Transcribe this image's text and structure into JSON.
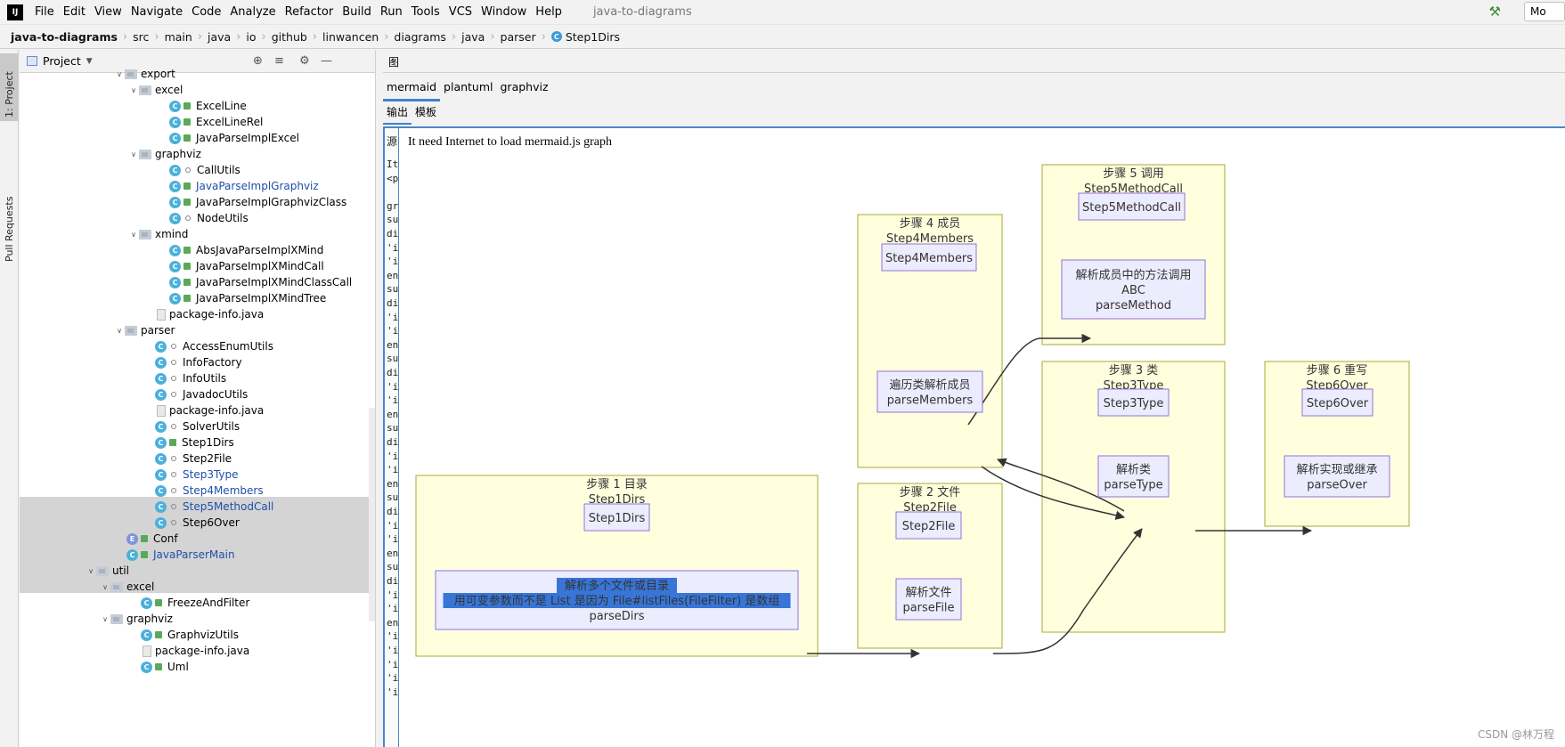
{
  "app": {
    "logo": "IJ",
    "window_title": "java-to-diagrams",
    "menu": [
      "File",
      "Edit",
      "View",
      "Navigate",
      "Code",
      "Analyze",
      "Refactor",
      "Build",
      "Run",
      "Tools",
      "VCS",
      "Window",
      "Help"
    ]
  },
  "breadcrumbs": [
    "java-to-diagrams",
    "src",
    "main",
    "java",
    "io",
    "github",
    "linwancen",
    "diagrams",
    "java",
    "parser",
    "Step1Dirs"
  ],
  "toolbar": {
    "run_config_label": "Mo",
    "hammer_icon": "hammer-icon"
  },
  "tool_stripe": {
    "project": "1: Project",
    "pull_requests": "Pull Requests"
  },
  "project_panel": {
    "title": "Project",
    "tree": [
      {
        "label": "export",
        "type": "folder",
        "arrow": "down"
      },
      {
        "label": "excel",
        "type": "folder",
        "arrow": "down"
      },
      {
        "label": "ExcelLine",
        "type": "class",
        "mod": "pub"
      },
      {
        "label": "ExcelLineRel",
        "type": "class",
        "mod": "pub"
      },
      {
        "label": "JavaParseImplExcel",
        "type": "class",
        "mod": "pub"
      },
      {
        "label": "graphviz",
        "type": "folder",
        "arrow": "down"
      },
      {
        "label": "CallUtils",
        "type": "class",
        "mod": "pkg"
      },
      {
        "label": "JavaParseImplGraphviz",
        "type": "class",
        "mod": "pub",
        "color": "blue"
      },
      {
        "label": "JavaParseImplGraphvizClass",
        "type": "class",
        "mod": "pub"
      },
      {
        "label": "NodeUtils",
        "type": "class",
        "mod": "pkg"
      },
      {
        "label": "xmind",
        "type": "folder",
        "arrow": "down"
      },
      {
        "label": "AbsJavaParseImplXMind",
        "type": "class",
        "mod": "pub"
      },
      {
        "label": "JavaParseImplXMindCall",
        "type": "class",
        "mod": "pub"
      },
      {
        "label": "JavaParseImplXMindClassCall",
        "type": "class",
        "mod": "pub"
      },
      {
        "label": "JavaParseImplXMindTree",
        "type": "class",
        "mod": "pub"
      },
      {
        "label": "package-info.java",
        "type": "file"
      },
      {
        "label": "parser",
        "type": "folder",
        "arrow": "down"
      },
      {
        "label": "AccessEnumUtils",
        "type": "class",
        "mod": "pkg"
      },
      {
        "label": "InfoFactory",
        "type": "class",
        "mod": "pkg"
      },
      {
        "label": "InfoUtils",
        "type": "class",
        "mod": "pkg"
      },
      {
        "label": "JavadocUtils",
        "type": "class",
        "mod": "pkg"
      },
      {
        "label": "package-info.java",
        "type": "file"
      },
      {
        "label": "SolverUtils",
        "type": "class",
        "mod": "pkg"
      },
      {
        "label": "Step1Dirs",
        "type": "class",
        "mod": "pub"
      },
      {
        "label": "Step2File",
        "type": "class",
        "mod": "pkg"
      },
      {
        "label": "Step3Type",
        "type": "class",
        "mod": "pkg",
        "color": "blue"
      },
      {
        "label": "Step4Members",
        "type": "class",
        "mod": "pkg",
        "color": "blue"
      },
      {
        "label": "Step5MethodCall",
        "type": "class",
        "mod": "pkg",
        "color": "blue"
      },
      {
        "label": "Step6Over",
        "type": "class",
        "mod": "pkg"
      },
      {
        "label": "Conf",
        "type": "enum",
        "mod": "pub"
      },
      {
        "label": "JavaParserMain",
        "type": "class",
        "mod": "pub",
        "color": "blue"
      },
      {
        "label": "util",
        "type": "folder",
        "arrow": "down"
      },
      {
        "label": "excel",
        "type": "folder",
        "arrow": "down"
      },
      {
        "label": "FreezeAndFilter",
        "type": "class",
        "mod": "pub"
      },
      {
        "label": "graphviz",
        "type": "folder",
        "arrow": "down"
      },
      {
        "label": "GraphvizUtils",
        "type": "class",
        "mod": "pub"
      },
      {
        "label": "package-info.java",
        "type": "file"
      },
      {
        "label": "Uml",
        "type": "class",
        "mod": "pub"
      }
    ]
  },
  "diagram_panel": {
    "title": "图",
    "engine_tabs": [
      "mermaid",
      "plantuml",
      "graphviz"
    ],
    "mode_tabs": [
      "输出",
      "模板"
    ],
    "source_label": "源",
    "source_lines": [
      "It",
      "<p",
      "",
      "gr",
      "su",
      "di",
      "'i",
      "'i",
      "en",
      "su",
      "di",
      "'i",
      "'i",
      "en",
      "su",
      "di",
      "'i",
      "'i",
      "en",
      "su",
      "di",
      "'i",
      "'i",
      "en",
      "su",
      "di",
      "'i",
      "'i",
      "en",
      "su",
      "di",
      "'i",
      "'i",
      "en",
      "'i",
      "'i",
      "'i",
      "'i",
      "'i"
    ],
    "notice": "It need Internet to load mermaid.js graph",
    "watermark": "CSDN @林万程"
  },
  "graph": {
    "subgraphs": [
      {
        "id": "s1",
        "title": "步骤 1 目录",
        "subtitle": "Step1Dirs"
      },
      {
        "id": "s2",
        "title": "步骤 2 文件",
        "subtitle": "Step2File"
      },
      {
        "id": "s3",
        "title": "步骤 3 类",
        "subtitle": "Step3Type"
      },
      {
        "id": "s4",
        "title": "步骤 4 成员",
        "subtitle": "Step4Members"
      },
      {
        "id": "s5",
        "title": "步骤 5 调用",
        "subtitle": "Step5MethodCall"
      },
      {
        "id": "s6",
        "title": "步骤 6 重写",
        "subtitle": "Step6Over"
      }
    ],
    "nodes": [
      {
        "id": "n1",
        "lines": [
          "Step1Dirs"
        ]
      },
      {
        "id": "n1b",
        "lines": [
          "解析多个文件或目录",
          "用可变参数而不是 List 是因为 File#listFiles(FileFilter) 是数组",
          "parseDirs"
        ]
      },
      {
        "id": "n2",
        "lines": [
          "Step2File"
        ]
      },
      {
        "id": "n2b",
        "lines": [
          "解析文件",
          "parseFile"
        ]
      },
      {
        "id": "n3",
        "lines": [
          "Step3Type"
        ]
      },
      {
        "id": "n3b",
        "lines": [
          "解析类",
          "parseType"
        ]
      },
      {
        "id": "n4",
        "lines": [
          "Step4Members"
        ]
      },
      {
        "id": "n4b",
        "lines": [
          "遍历类解析成员",
          "parseMembers"
        ]
      },
      {
        "id": "n5",
        "lines": [
          "Step5MethodCall"
        ]
      },
      {
        "id": "n5b",
        "lines": [
          "解析成员中的方法调用",
          "ABC",
          "parseMethod"
        ]
      },
      {
        "id": "n6",
        "lines": [
          "Step6Over"
        ]
      },
      {
        "id": "n6b",
        "lines": [
          "解析实现或继承",
          "parseOver"
        ]
      }
    ],
    "colors": {
      "cluster_fill": "#ffffde",
      "cluster_stroke": "#aaaa33",
      "node_fill": "#ececff",
      "node_stroke": "#9370db",
      "selection": "#3875d7"
    }
  }
}
